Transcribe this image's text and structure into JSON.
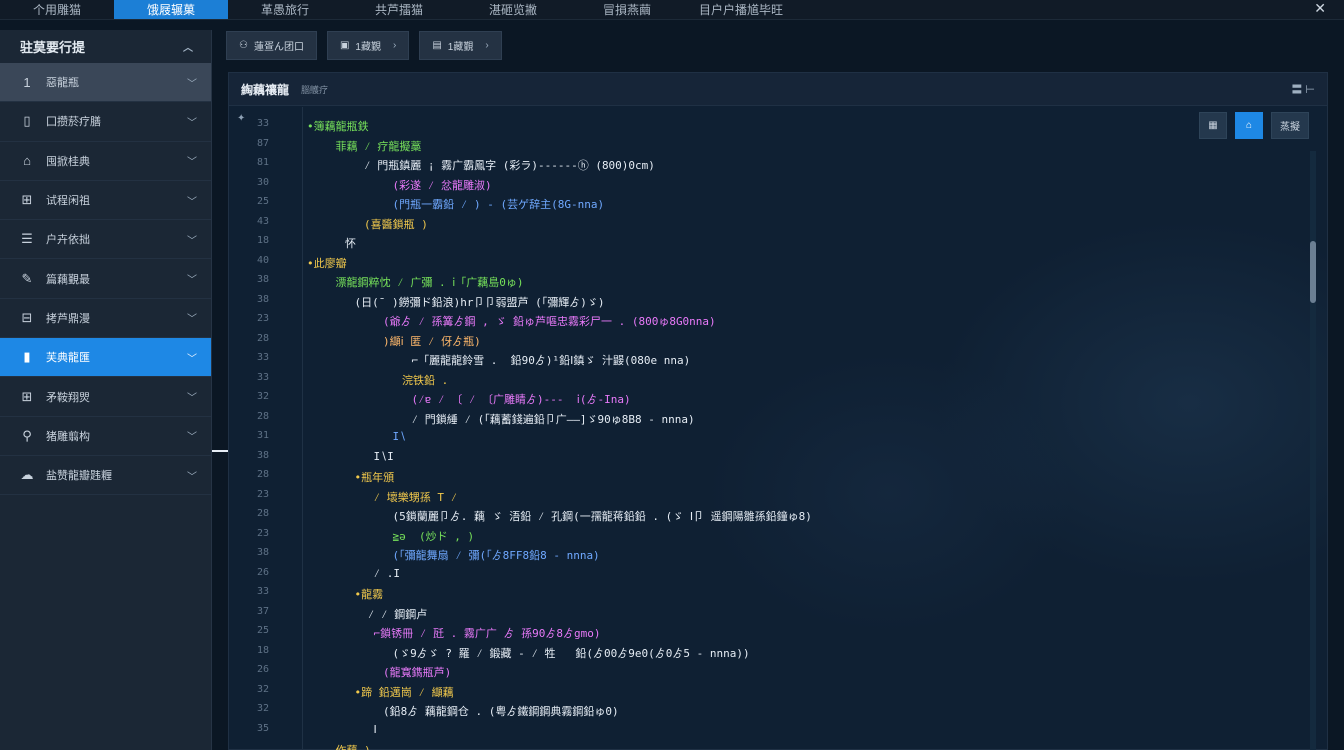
{
  "topbar": {
    "tabs": [
      "个用雕猫",
      "饿屐辗菓",
      "革愚旅行",
      "共芦擂猫",
      "湛砸览撇",
      "冒損燕繭",
      "目户户播馗毕旺"
    ],
    "active_index": 1,
    "close_icon": "close-icon"
  },
  "sidebar": {
    "title": "驻莫要行提",
    "collapse_icon": "chevron-up-icon",
    "items": [
      {
        "icon": "number-one-icon",
        "glyph": "1",
        "label": "惡龍瓶"
      },
      {
        "icon": "document-icon",
        "glyph": "▯",
        "label": "囗攒菸疗膳"
      },
      {
        "icon": "bank-icon",
        "glyph": "⌂",
        "label": "囤掀桂典"
      },
      {
        "icon": "table-icon",
        "glyph": "⊞",
        "label": "试程闲祖"
      },
      {
        "icon": "list-icon",
        "glyph": "☰",
        "label": "户卉依拙"
      },
      {
        "icon": "pen-icon",
        "glyph": "✎",
        "label": "篇藕覲最"
      },
      {
        "icon": "form-icon",
        "glyph": "⊟",
        "label": "拷芦鼎漫"
      },
      {
        "icon": "bar-chart-icon",
        "glyph": "▮",
        "label": "芙典龍匯"
      },
      {
        "icon": "grid-icon",
        "glyph": "⊞",
        "label": "矛鞍翔焸"
      },
      {
        "icon": "search-icon",
        "glyph": "⚲",
        "label": "猪雕翦构"
      },
      {
        "icon": "cloud-icon",
        "glyph": "☁",
        "label": "盐赞龍瓣韪糎"
      }
    ],
    "active_index": 7
  },
  "toolbar": {
    "buttons": [
      {
        "icon": "user-icon",
        "glyph": "⚇",
        "label": "蓮疍ん团口"
      },
      {
        "icon": "camera-icon",
        "glyph": "▣",
        "label": "1藏覲"
      },
      {
        "icon": "folder-icon",
        "glyph": "▤",
        "label": "1藏覲"
      }
    ]
  },
  "panel": {
    "title": "綯藕禳龍",
    "subtitle": "腦鸌疗",
    "right_text": "〓 ⊢",
    "editor_buttons": [
      {
        "icon": "square-icon",
        "label": "▦"
      },
      {
        "icon": "home-icon",
        "label": "⌂"
      },
      {
        "icon": "preview-icon",
        "label": "蒸擬"
      }
    ],
    "line_numbers": [
      "33",
      "87",
      "81",
      "30",
      "25",
      "43",
      "18",
      "40",
      "38",
      "38",
      "23",
      "28",
      "33",
      "33",
      "32",
      "28",
      "31",
      "38",
      "28",
      "23",
      "28",
      "23",
      "38",
      "26",
      "33",
      "37",
      "25",
      "18",
      "26",
      "32",
      "32",
      "35"
    ],
    "code": [
      {
        "indent": 0,
        "color": "green",
        "text": "•簿藕龍瓶鉄"
      },
      {
        "indent": 3,
        "color": "green",
        "text": "菲藕 ⁄ 疗龍擬藁"
      },
      {
        "indent": 6,
        "color": "white",
        "text": "⁄ 門瓶鎮麗 ¡ 霧广霸鳳字 (彩ラ)------ⓗ (800)0cm)"
      },
      {
        "indent": 9,
        "color": "pink",
        "text": "(彩遂 ⁄ 忿龍雕淑)"
      },
      {
        "indent": 9,
        "color": "blue",
        "text": "(門瓶一霸鉛 ⁄ ) - (芸ゲ辞主(8G-nna)"
      },
      {
        "indent": 6,
        "color": "yellow",
        "text": "(喜醬鎖瓶 )"
      },
      {
        "indent": 4,
        "color": "white",
        "text": "怀"
      },
      {
        "indent": 0,
        "color": "yellow",
        "text": "•此廖瓣"
      },
      {
        "indent": 3,
        "color": "green",
        "text": "漂龍鋼粹忱 ⁄ 广彌 . ⅰ「广藕島0ゅ)"
      },
      {
        "indent": 5,
        "color": "white",
        "text": "(日(¯ )鐒彌ド鉛浪)hr卩卩弱盟芦 (「彌輝ゟ)ゞ)"
      },
      {
        "indent": 8,
        "color": "pink",
        "text": "(爺ゟ ⁄ 孫篝ゟ鋼 , ゞ 鉛ゅ芦嘔忠霧彩尸一 . (800ゅ8G0nna)"
      },
      {
        "indent": 8,
        "color": "orange",
        "text": ")纈ⅰ 匿 ⁄ 伢ゟ瓶)"
      },
      {
        "indent": 11,
        "color": "white",
        "text": "⌐「麗龍龍鈴雪 .  鉛90ゟ)¹鉛Ⅰ鎮ゞ 汁鼹(080e nna)"
      },
      {
        "indent": 10,
        "color": "yellow",
        "text": "浣铁鉛 ."
      },
      {
        "indent": 11,
        "color": "pink",
        "text": "(⁄ɐ ⁄ 〔 ⁄ 〔广雕睛ゟ)---  ⅰ(ゟ-Ina)"
      },
      {
        "indent": 11,
        "color": "white",
        "text": "⁄ 門鎖綞 ⁄ (「藕蓄錢遍鉛卩广——]ゞ90ゅ8B8 - nnna)"
      },
      {
        "indent": 9,
        "color": "blue",
        "text": "I∖"
      },
      {
        "indent": 7,
        "color": "white",
        "text": "I∖I"
      },
      {
        "indent": 5,
        "color": "yellow",
        "text": "•瓶年頒"
      },
      {
        "indent": 7,
        "color": "yellow",
        "text": "⁄ 壞樂甥孫 T ⁄ "
      },
      {
        "indent": 9,
        "color": "white",
        "text": "(5鎖蘭麗卩ゟ. 藕 ゞ 浯鉛 ⁄ 孔鋼(一孺龍蒋鉛鉛 . (ゞ Ⅰ卩 遥鋼陽雛孫鉛鐘ゅ8)"
      },
      {
        "indent": 9,
        "color": "green",
        "text": "≧ə  (炒ド , )"
      },
      {
        "indent": 9,
        "color": "blue",
        "text": "(「彌龍舞扇 ⁄ 彌(「ゟ8FF8鉛8 - nnna)"
      },
      {
        "indent": 7,
        "color": "white",
        "text": "⁄ .I"
      },
      {
        "indent": 5,
        "color": "yellow",
        "text": "•龍霧"
      },
      {
        "indent": 5,
        "color": "white",
        "text": "  ⁄ ⁄ 鋼鋼卢"
      },
      {
        "indent": 7,
        "color": "pink",
        "text": "⌐鎖锈冊 ⁄ 瓩 . 霧广广 ゟ 孫90ゟ8ゟgmo)"
      },
      {
        "indent": 9,
        "color": "white",
        "text": "(ゞ9ゟゞ ? 羅 ⁄ 鍛藏 - ⁄ 牲   鉛(ゟ00ゟ9e0(ゟ0ゟ5 - nnna))"
      },
      {
        "indent": 8,
        "color": "pink",
        "text": "(龍寬鐫瓶芦)"
      },
      {
        "indent": 5,
        "color": "yellow",
        "text": "•蹄 鉛邁崗 ⁄ 纈藕"
      },
      {
        "indent": 8,
        "color": "white",
        "text": "(鉛8ゟ 藕龍鋼仓 . (粤ゟ鐵鋼鋼典霧鋼鉛ゅ0)"
      },
      {
        "indent": 7,
        "color": "white",
        "text": "Ⅰ"
      },
      {
        "indent": 3,
        "color": "yellow",
        "text": "作藕 )"
      }
    ]
  }
}
